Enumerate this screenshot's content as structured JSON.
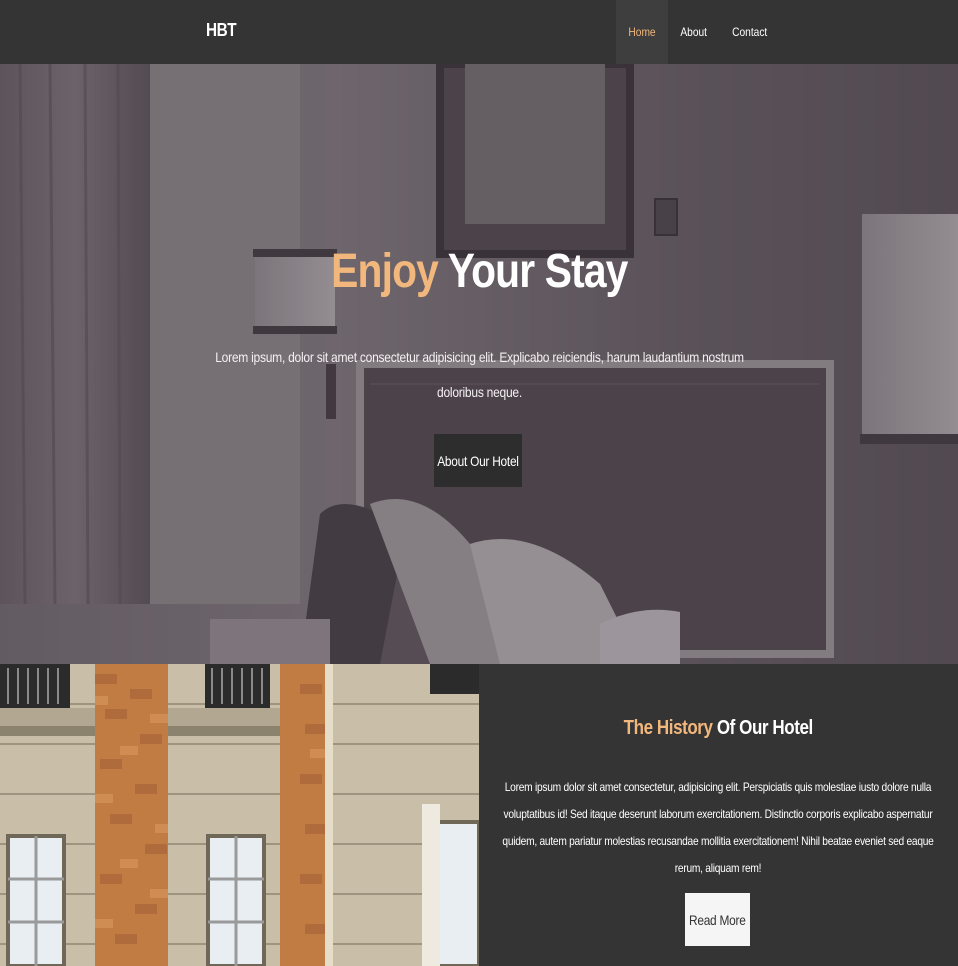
{
  "navbar": {
    "brand": "HBT",
    "links": [
      {
        "label": "Home",
        "active": true
      },
      {
        "label": "About",
        "active": false
      },
      {
        "label": "Contact",
        "active": false
      }
    ]
  },
  "hero": {
    "title_accent": "Enjoy",
    "title_rest": " Your Stay",
    "text": "Lorem ipsum, dolor sit amet consectetur adipisicing elit. Explicabo reiciendis, harum laudantium nostrum doloribus neque.",
    "button_label": "About Our Hotel"
  },
  "history": {
    "title_accent": "The History",
    "title_rest": " Of Our Hotel",
    "text": "Lorem ipsum dolor sit amet consectetur, adipisicing elit. Perspiciatis quis molestiae iusto dolore nulla voluptatibus id! Sed itaque deserunt laborum exercitationem. Distinctio corporis explicabo aspernatur quidem, autem pariatur molestias recusandae mollitia exercitationem! Nihil beatae eveniet sed eaque rerum, aliquam rem!",
    "button_label": "Read More"
  },
  "colors": {
    "accent": "#f2b77c",
    "navbar_bg": "#343434",
    "panel_bg": "#343434"
  }
}
